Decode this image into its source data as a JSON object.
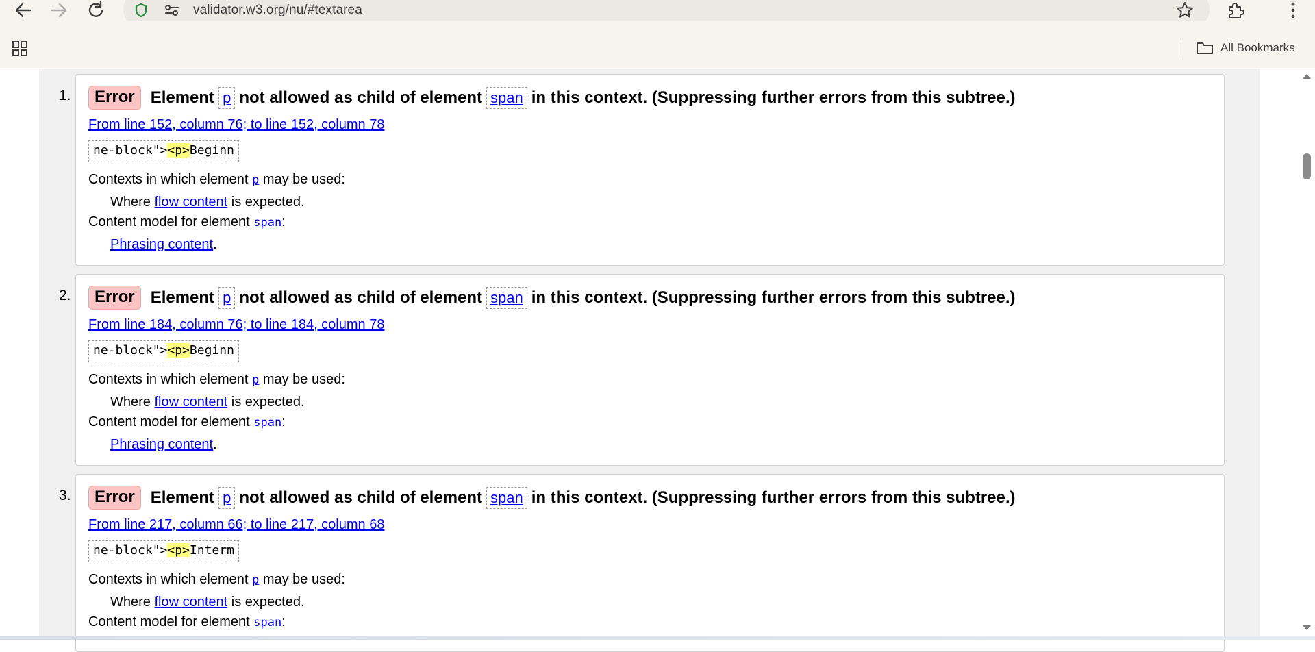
{
  "browser": {
    "url": "validator.w3.org/nu/#textarea",
    "bookmarks_label": "All Bookmarks"
  },
  "messages": [
    {
      "number": "1.",
      "type": "Error",
      "head_prefix": "Element",
      "element": "p",
      "head_middle": "not allowed as child of element",
      "parent": "span",
      "head_suffix": "in this context. (Suppressing further errors from this subtree.)",
      "location": "From line 152, column 76; to line 152, column 78",
      "extract_before": "ne-block\">",
      "extract_highlight": "<p>",
      "extract_after": "Beginn",
      "contexts_prefix": "Contexts in which element",
      "contexts_element": "p",
      "contexts_suffix": "may be used:",
      "where_prefix": "Where",
      "where_link": "flow content",
      "where_suffix": "is expected.",
      "model_prefix": "Content model for element",
      "model_element": "span",
      "model_suffix": ":",
      "model_link": "Phrasing content",
      "model_link_suffix": "."
    },
    {
      "number": "2.",
      "type": "Error",
      "head_prefix": "Element",
      "element": "p",
      "head_middle": "not allowed as child of element",
      "parent": "span",
      "head_suffix": "in this context. (Suppressing further errors from this subtree.)",
      "location": "From line 184, column 76; to line 184, column 78",
      "extract_before": "ne-block\">",
      "extract_highlight": "<p>",
      "extract_after": "Beginn",
      "contexts_prefix": "Contexts in which element",
      "contexts_element": "p",
      "contexts_suffix": "may be used:",
      "where_prefix": "Where",
      "where_link": "flow content",
      "where_suffix": "is expected.",
      "model_prefix": "Content model for element",
      "model_element": "span",
      "model_suffix": ":",
      "model_link": "Phrasing content",
      "model_link_suffix": "."
    },
    {
      "number": "3.",
      "type": "Error",
      "head_prefix": "Element",
      "element": "p",
      "head_middle": "not allowed as child of element",
      "parent": "span",
      "head_suffix": "in this context. (Suppressing further errors from this subtree.)",
      "location": "From line 217, column 66; to line 217, column 68",
      "extract_before": "ne-block\">",
      "extract_highlight": "<p>",
      "extract_after": "Interm",
      "contexts_prefix": "Contexts in which element",
      "contexts_element": "p",
      "contexts_suffix": "may be used:",
      "where_prefix": "Where",
      "where_link": "flow content",
      "where_suffix": "is expected.",
      "model_prefix": "Content model for element",
      "model_element": "span",
      "model_suffix": ":"
    }
  ]
}
